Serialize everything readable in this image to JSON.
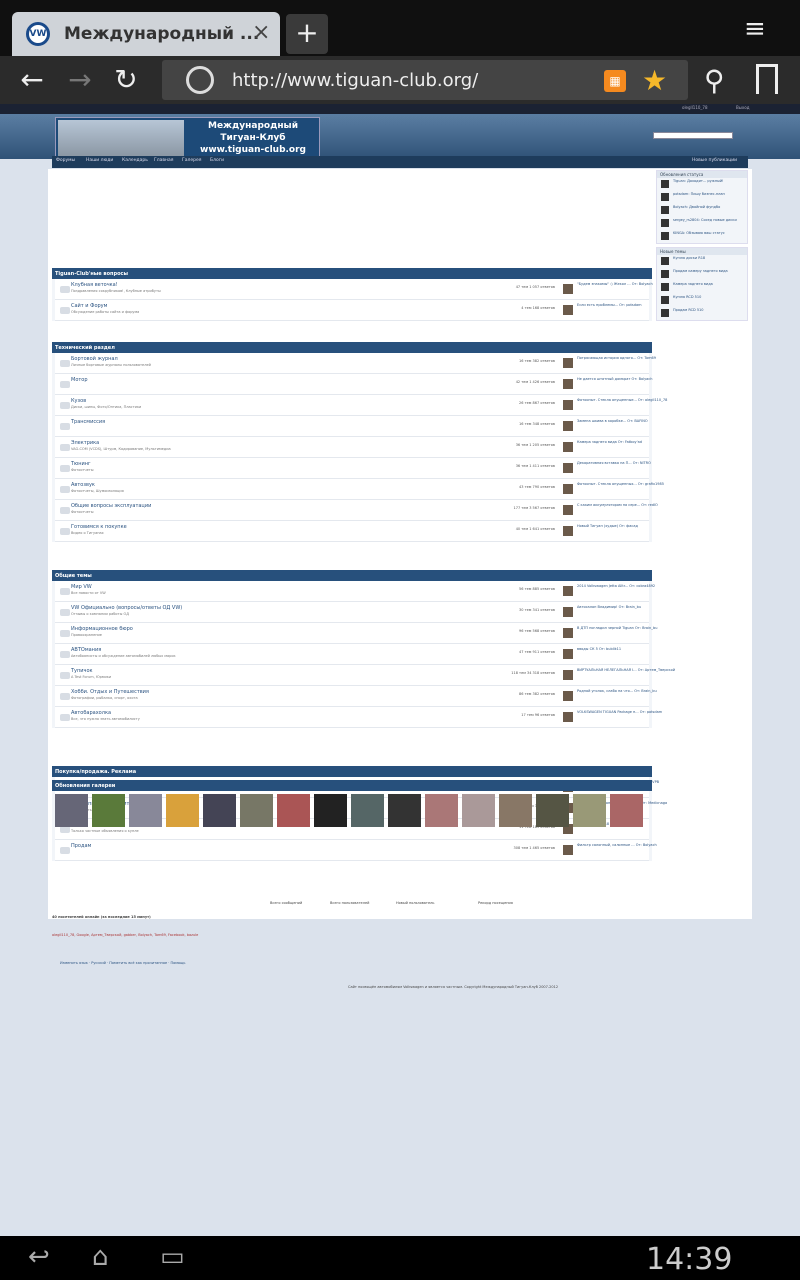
{
  "browser": {
    "tab_title": "Международный ...",
    "favicon": "VW",
    "close": "×",
    "new_tab": "+",
    "menu": "≡",
    "back": "←",
    "forward": "→",
    "reload": "↻",
    "url": "http://www.tiguan-club.org/",
    "rss": "▦",
    "star": "★",
    "search": "⚲"
  },
  "site": {
    "top_user": "olegll110_78",
    "top_exit": "Выход",
    "logo_l1": "Международный",
    "logo_l2": "Тигуан-Клуб",
    "logo_l3": "www.tiguan-club.org",
    "nav": [
      "Форумы",
      "Наши люди",
      "Календарь",
      "Главная",
      "Галерея",
      "Блоги"
    ],
    "new_pubs": "Новые публикации"
  },
  "cats": [
    {
      "title": "Tiguan-Club'ные вопросы",
      "rows": [
        {
          "name": "Клубная веточка!",
          "desc": "Поздравления сокрубников!, Клубные атрибуты",
          "stats": "47 тем 1 057 ответов",
          "last": "\"Будем знакомы\" :) Жекол ... От: Bolyach"
        },
        {
          "name": "Сайт и Форум",
          "desc": "Обсуждение работы сайта и форума",
          "stats": "4 тем 168 ответов",
          "last": "Если есть проблемы... От: potsdam"
        }
      ]
    },
    {
      "title": "Технический раздел",
      "rows": [
        {
          "name": "Бортовой журнал",
          "desc": "Личные бортовые журналы пользователей",
          "stats": "16 тем 382 ответов",
          "last": "Потрясающая история одного... От: Tom69"
        },
        {
          "name": "Мотор",
          "desc": "",
          "stats": "42 тем 1 426 ответов",
          "last": "Не дается штатный домкрат От: Bolyach"
        },
        {
          "name": "Кузов",
          "desc": "Диски, шины, Фото/Оптика, Пластики",
          "stats": "26 тем 867 ответов",
          "last": "Фотоопыт. Стекла опущенные... От: olegll110_78"
        },
        {
          "name": "Трансмиссия",
          "desc": "",
          "stats": "16 тем 348 ответов",
          "last": "Замена шкива в коробке... От: BAFINO"
        },
        {
          "name": "Электрика",
          "desc": "VAG-COM (VCDS), Штурм, Кодирование, Мультимедиа",
          "stats": "36 тем 1 205 ответов",
          "last": "Камера заднего вида От: Fatboy'ad"
        },
        {
          "name": "Тюнинг",
          "desc": "Фотоотчеты",
          "stats": "36 тем 1 411 ответов",
          "last": "Декоративная вставка на П... От: NITRO"
        },
        {
          "name": "Автозвук",
          "desc": "Фотоотчеты, Шумоизоляция",
          "stats": "43 тем 790 ответов",
          "last": "Фотоопыт. Стекла опущенных... От: grafix1985"
        },
        {
          "name": "Общие вопросы эксплуатации",
          "desc": "Фотоотчеты",
          "stats": "177 тем 3 567 ответов",
          "last": "С каким аккумулятором на сере... От: redIO"
        },
        {
          "name": "Готовимся к покупке",
          "desc": "Видео о Тигуанах",
          "stats": "40 тем 1 641 ответов",
          "last": "Новый Тигуан (худые) От: фасад"
        }
      ]
    },
    {
      "title": "Общие темы",
      "rows": [
        {
          "name": "Мир VW",
          "desc": "Все новости от VW",
          "stats": "56 тем 885 ответов",
          "last": "2014 Volkswagen Jetta Alltr... От: cobra4892"
        },
        {
          "name": "VW Официально (вопросы/ответы ОД VW)",
          "desc": "Отзывы о компании работы ОД",
          "stats": "30 тем 341 ответов",
          "last": "Автосалон Владимир! От: Brain_bu"
        },
        {
          "name": "Информационное бюро",
          "desc": "Правоохранение",
          "stats": "96 тем 568 ответов",
          "last": "В ДТП погладил черной Tiguan От: Brain_bu"
        },
        {
          "name": "АВТОмания",
          "desc": "Автобоянисты и обсуждение автомобилей любых марок",
          "stats": "47 тем 911 ответов",
          "last": "вводы СК 5 От: bublik11"
        },
        {
          "name": "Тупичок",
          "desc": "A Test Forum, Юрмики",
          "stats": "118 тем 34 318 ответов",
          "last": "ВИРТУАЛЬНАЯ НЕЛЕГАЛЬНАЯ I... От: Артем_Тверской"
        },
        {
          "name": "Хобби. Отдых и Путешествия",
          "desc": "Фотографии, рыбалка, спорт, охота",
          "stats": "86 тем 382 ответов",
          "last": "Родной уголок, слабо на что... От: Brain_bu"
        },
        {
          "name": "Автобарахолка",
          "desc": "Все, что нужно знать автомобилисту",
          "stats": "17 тем 96 ответов",
          "last": "VOLKSWAGEN TIGUAN Package н... От: potsdam"
        }
      ]
    },
    {
      "title": "Покупка/продажа. Реклама",
      "rows": [
        {
          "name": "Партнеры Тигуан-Клуба",
          "desc": "Партнерства, СТО, Wallex, Тигуан Актив, Страховые компании",
          "stats": "17 тем 319 ответов",
          "last": "Fatboy VPB форма Скидка 5... От: Fatboy VPB"
        },
        {
          "name": "Где купить, обслужиться.",
          "desc": "Где купить, обслужиться",
          "stats": "8 тем 35 ответов",
          "last": "Ремонтный ремонт американцы... От: Medicnaga"
        },
        {
          "name": "Куплю",
          "desc": "Только частные объявления о купле",
          "stats": "11 тем 183 ответов",
          "last": "Куплю диски R18 От: Нишигра"
        },
        {
          "name": "Продам",
          "desc": "",
          "stats": "308 тем 1 465 ответов",
          "last": "Фильтр салонный, салонные ... От: Bolyach"
        }
      ]
    }
  ],
  "gallery_title": "Обновления галереи",
  "side": {
    "status_title": "Обновления статуса",
    "statuses": [
      "Tiguan: Доходит... ружный!",
      "potsdam: Пишу бизнес-план",
      "Bolyach: Двойной фундбо",
      "sergey_rs2804: Сосед новые диски",
      "KINGA: Обзываю ваш статус"
    ],
    "topics_title": "Новые темы",
    "topics": [
      "Куплю диски R18",
      "Продам камеру заднего вида",
      "Камера заднего вида",
      "Куплю RCD 510",
      "Продам RCD 510"
    ]
  },
  "footer": {
    "online": "40 посетителей онлайн (за последние 15 минут)",
    "users": "olegll110_78, Google, Артем_Тверской, gabber, Bolyach, Tom69, Facebook, bazule",
    "stats": [
      "Всего сообщений",
      "Всего пользователей",
      "Новый пользователь",
      "Рекорд посещения"
    ],
    "links": "Изменить язык · Русский · Пометить всё как прочитанное · Помощь",
    "copy": "Сайт посвящён автомобилям Volkswagen и является частным. Copyright Международный Тигуан-Клуб 2007-2012"
  },
  "system": {
    "back": "↩",
    "home": "⌂",
    "recent": "▭",
    "time": "14:39"
  }
}
